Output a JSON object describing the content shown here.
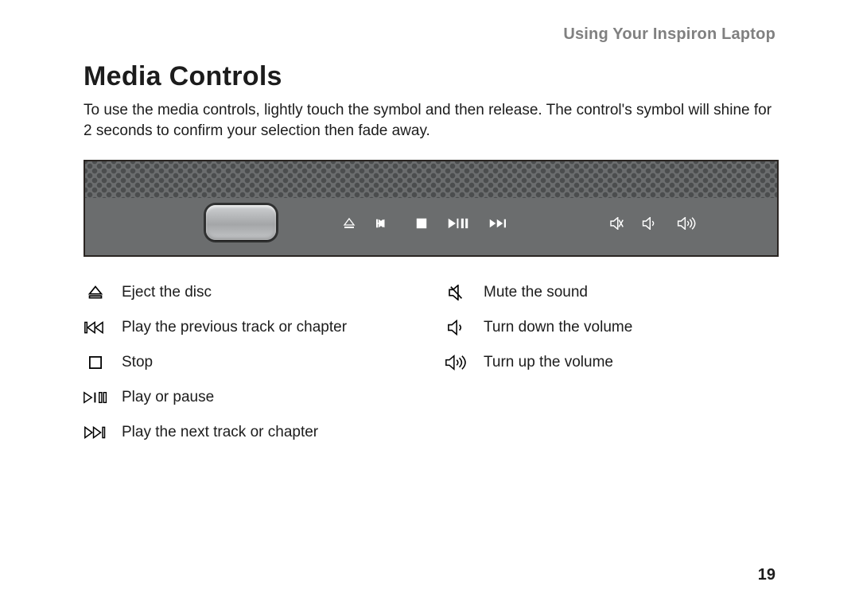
{
  "header": {
    "running_head": "Using Your Inspiron Laptop"
  },
  "section": {
    "title": "Media Controls",
    "intro": "To use the media controls, lightly touch the symbol and then release. The control's symbol will shine for 2 seconds to confirm your selection then fade away."
  },
  "legend": {
    "left": [
      {
        "icon": "eject",
        "label": "Eject the disc"
      },
      {
        "icon": "prev",
        "label": "Play the previous track or chapter"
      },
      {
        "icon": "stop",
        "label": "Stop"
      },
      {
        "icon": "playpause",
        "label": "Play or pause"
      },
      {
        "icon": "next",
        "label": "Play the next track or chapter"
      }
    ],
    "right": [
      {
        "icon": "mute",
        "label": "Mute the sound"
      },
      {
        "icon": "vol-down",
        "label": "Turn down the volume"
      },
      {
        "icon": "vol-up",
        "label": "Turn up the volume"
      }
    ]
  },
  "page_number": "19"
}
